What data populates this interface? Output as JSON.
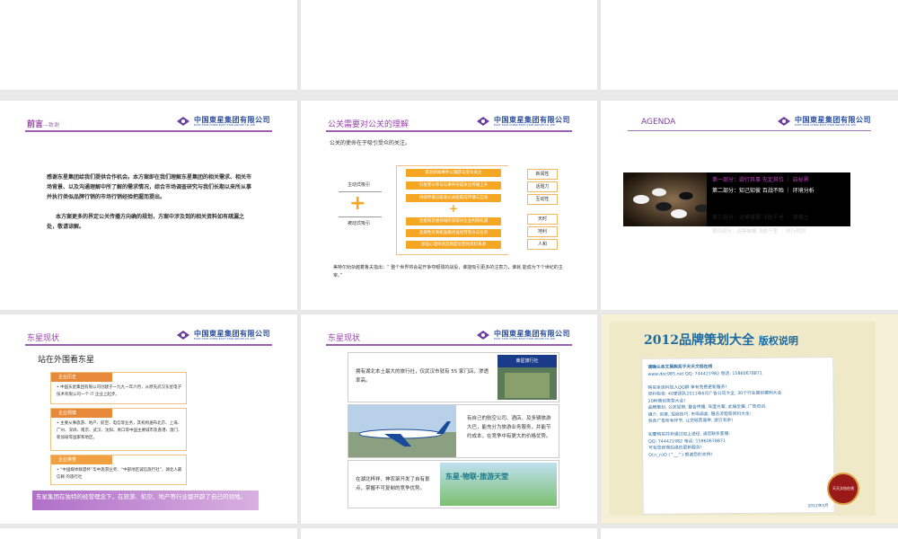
{
  "logo": {
    "cn": "中国東星集团有限公司",
    "en": "EAST STAR  CHINA EAST STAR GROUP CO.,LTD"
  },
  "preface": {
    "title": "前言",
    "subtitle": "—致谢",
    "p1": "感谢东星集团给我们提供合作机会。本方案即在我们理解东星集团的相关需求、相关市场背景、以及沟通理解中所了解的需求情况，综合市场调查研究与我们长期以来所从事并执行类似品牌行销的市场行销经验把握而提出。",
    "p2": "本方案更多的界定公关传播方向确的规划，方案中涉及到的相关资料如有疏漏之处，敬请谅解。"
  },
  "pr": {
    "title": "公关需要对公关的理解",
    "intro": "公关的使命在于吸引受众的关注。",
    "active": "主动式吸引",
    "passive": "被动式吸引",
    "top_boxes": [
      "策划新闻事件以捕获与受众关注",
      "引发受众参与与事件形成关注传播上升",
      "持续传播与吸收公关吸取成传播与互动"
    ],
    "bottom_boxes": [
      "连接和思维领域所获取对企业利销机遇",
      "选择性有商机准确对准经营受众与任务",
      "加强心理体验及精度化营的资料来源"
    ],
    "right_top": [
      "新闻性",
      "话题力",
      "互动性"
    ],
    "right_bottom": [
      "天时",
      "地利",
      "人和"
    ],
    "quote": "美特尔劝杂越着鲁夫指出：",
    "quote2": "“ 整个世界将会是开争夺眼球的战役，谁能吸引更多的注意力，谁就 能成为下个世纪的主宰。”"
  },
  "agenda": {
    "title": "AGENDA",
    "items": [
      "第一部分：欲行其事 先定其位 ｜ 启标界",
      "第二部分：知己知彼 百战不殆 ｜ 环境分析",
      "第三部分：运筹帷幄 决胜千里 ｜ 策略之",
      "第四部分：运筹帷幄 决胜千里 ｜ 执行规划"
    ]
  },
  "status": {
    "title": "东星现状",
    "heading": "站在外围看东星",
    "sections": [
      {
        "label": "企业历史",
        "color": "#e8893a",
        "text": "• 中国东星集团有限公司创建于一九九一年六月，从原先武汉东星电子技术有限公司一个 IT 企业上起步。"
      },
      {
        "label": "企业规模",
        "color": "#e8893a",
        "text": "• 主要从事旅游、地产、航空、电信等业务，其机构遍布北京、上海、广州、深圳、南京、武汉、沈阳、青口等中国主要城市及香港、澳门、新加坡等国家和地区。"
      },
      {
        "label": "企业荣誉",
        "color": "#f0a040",
        "text": "• “中国媒体联盟杯”华中旅游业奖、“中部地区诚信旅行社”，湖北人最信赖 的旅行社"
      }
    ],
    "banner": "东星集团在独特的经营理念下，在旅游、航空、地产等行业都开辟了自己的领地。"
  },
  "status2": {
    "title": "东星现状",
    "row1": "拥有湖北本土最大的旅行社，仅武汉市就有 55 家门店，渗透率高。",
    "row2": "有自己的航空公司、酒店、及多辆旅游大巴，能充分为旅游业务服务，并能节约成本，在竞争中有更大的价格优势。",
    "row3": "在湖北梓祥、神农架开发了自有景点，掌握不可复制的竞争优势。",
    "store_sign": "東星旅行社",
    "park_sign": "东星·物联·旅游天堂"
  },
  "copyright": {
    "title": "2012品牌策划大全",
    "title_suffix": "版权说明",
    "lines": [
      "请确认本文是购买于天天文档在线",
      "www.doc985.net     QQ: 744421982  电话: 15860678871",
      "",
      "购买本资料加入QQ群  享有免费更新服务!",
      "资料包含: 40家团队2011年6月广告公司大全, 30个行业策划案例大全",
      "20种策划类型大全!",
      "品牌策划, 公关促销, 整合传播, 年度方案, 此编全案, 广告培训,",
      "媒介, 创意, 招商技巧, 市场调查, 服务流程等资料大全;",
      "包含广告所有环节, 让您轻而易举, 游刃有余!",
      "",
      "如要购买并非通过如上途径, 请您联系客服:",
      "QQ: 744421982   电话: 15860678871",
      "可有您获得后续的更新服务!",
      "O(∩_∩)O    (^__^)   感谢您的支持!"
    ],
    "date": "2012年5月",
    "stamp": "天天文档在线"
  }
}
